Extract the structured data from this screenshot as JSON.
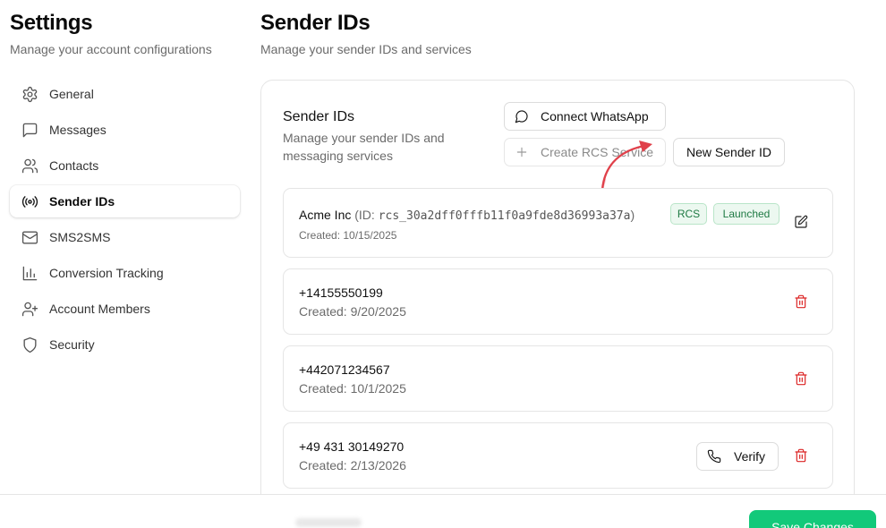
{
  "sidebar": {
    "title": "Settings",
    "subtitle": "Manage your account configurations",
    "items": [
      {
        "label": "General",
        "icon": "gear-icon"
      },
      {
        "label": "Messages",
        "icon": "message-square-icon"
      },
      {
        "label": "Contacts",
        "icon": "users-icon"
      },
      {
        "label": "Sender IDs",
        "icon": "radio-signal-icon",
        "active": true
      },
      {
        "label": "SMS2SMS",
        "icon": "mail-icon"
      },
      {
        "label": "Conversion Tracking",
        "icon": "bar-chart-icon"
      },
      {
        "label": "Account Members",
        "icon": "user-plus-icon"
      },
      {
        "label": "Security",
        "icon": "shield-icon"
      }
    ]
  },
  "main": {
    "title": "Sender IDs",
    "subtitle": "Manage your sender IDs and services"
  },
  "card": {
    "title": "Sender IDs",
    "description": "Manage your sender IDs and messaging services",
    "connect_whatsapp_label": "Connect WhatsApp",
    "create_rcs_label": "Create RCS Service",
    "new_sender_label": "New Sender ID"
  },
  "senders": [
    {
      "name": "Acme Inc",
      "id_prefix": "(ID: ",
      "id": "rcs_30a2dff0fffb11f0a9fde8d36993a37a",
      "id_suffix": ")",
      "badges": [
        "RCS",
        "Launched"
      ],
      "created": "Created: 10/15/2025"
    },
    {
      "name": "+14155550199",
      "created": "Created: 9/20/2025"
    },
    {
      "name": "+442071234567",
      "created": "Created: 10/1/2025"
    },
    {
      "name": "+49 431 30149270",
      "created": "Created: 2/13/2026",
      "verify_label": "Verify"
    }
  ],
  "footer": {
    "save_label": "Save Changes"
  },
  "colors": {
    "accent_green": "#12c97a",
    "danger": "#dc2626",
    "annotation_arrow": "#e0404a"
  }
}
